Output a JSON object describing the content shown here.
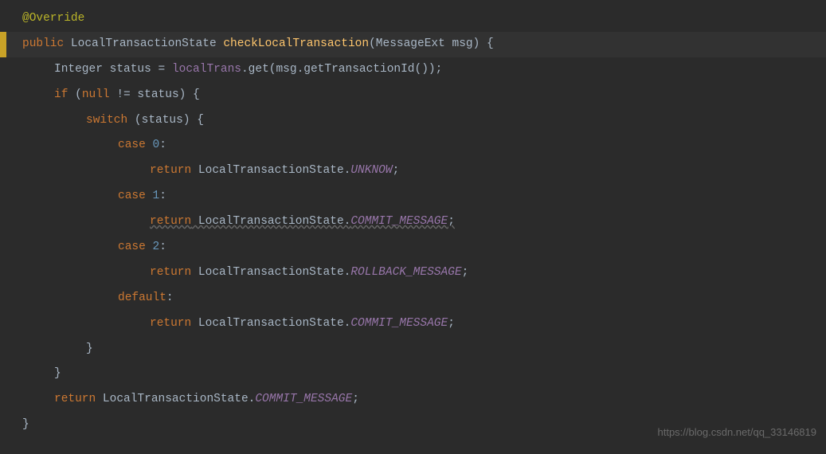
{
  "code": {
    "annotation": "@Override",
    "access": "public",
    "returnType": "LocalTransactionState",
    "methodName": "checkLocalTransaction",
    "paramType": "MessageExt",
    "paramName": "msg",
    "l3_type": "Integer",
    "l3_var": "status",
    "l3_op": " = ",
    "l3_field": "localTrans",
    "l3_call": ".get(msg.getTransactionId());",
    "if_kw": "if",
    "if_cond_open": " (",
    "null_kw": "null",
    "if_cond_rest": " != status) {",
    "switch_kw": "switch",
    "switch_cond": " (status) {",
    "case_kw": "case",
    "case0": "0",
    "case1": "1",
    "case2": "2",
    "colon": ":",
    "return_kw": "return",
    "lts": " LocalTransactionState.",
    "unknow": "UNKNOW",
    "commit": "COMMIT_MESSAGE",
    "rollback": "ROLLBACK_MESSAGE",
    "semi": ";",
    "default_kw": "default",
    "brace_close": "}",
    "return_final_pre": " LocalTransactionState.",
    "open_brace": "{",
    "close_paren_space_brace": ") {"
  },
  "watermark": "https://blog.csdn.net/qq_33146819"
}
